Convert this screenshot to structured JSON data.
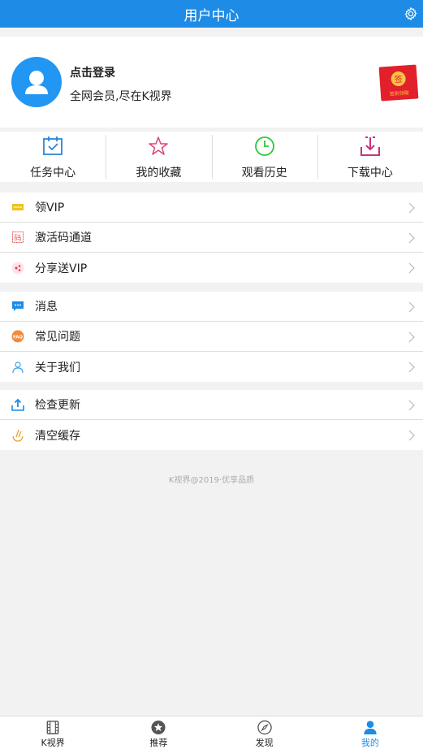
{
  "header": {
    "title": "用户中心"
  },
  "profile": {
    "title": "点击登录",
    "subtitle": "全网会员,尽在K视界",
    "redpack_text": "签到领取"
  },
  "grid": [
    {
      "label": "任务中心",
      "icon": "calendar-check-icon",
      "color": "#2e86d4"
    },
    {
      "label": "我的收藏",
      "icon": "star-icon",
      "color": "#e0437a"
    },
    {
      "label": "观看历史",
      "icon": "clock-icon",
      "color": "#2fc43a"
    },
    {
      "label": "下载中心",
      "icon": "download-icon",
      "color": "#c8337a"
    }
  ],
  "menu1": [
    {
      "label": "领VIP",
      "icon": "vip-ticket-icon"
    },
    {
      "label": "激活码通道",
      "icon": "activation-code-icon"
    },
    {
      "label": "分享送VIP",
      "icon": "share-icon"
    }
  ],
  "menu2": [
    {
      "label": "消息",
      "icon": "message-icon"
    },
    {
      "label": "常见问题",
      "icon": "faq-icon"
    },
    {
      "label": "关于我们",
      "icon": "about-us-icon"
    }
  ],
  "menu3": [
    {
      "label": "检查更新",
      "icon": "update-icon"
    },
    {
      "label": "清空缓存",
      "icon": "clear-cache-icon"
    }
  ],
  "footer_text": "K视界@2019·优享品质",
  "tabs": [
    {
      "label": "K视界",
      "icon": "film-icon",
      "active": false
    },
    {
      "label": "推荐",
      "icon": "star-badge-icon",
      "active": false
    },
    {
      "label": "发现",
      "icon": "compass-icon",
      "active": false
    },
    {
      "label": "我的",
      "icon": "user-icon",
      "active": true
    }
  ],
  "colors": {
    "accent": "#1e8ce6",
    "background": "#f2f2f2"
  }
}
